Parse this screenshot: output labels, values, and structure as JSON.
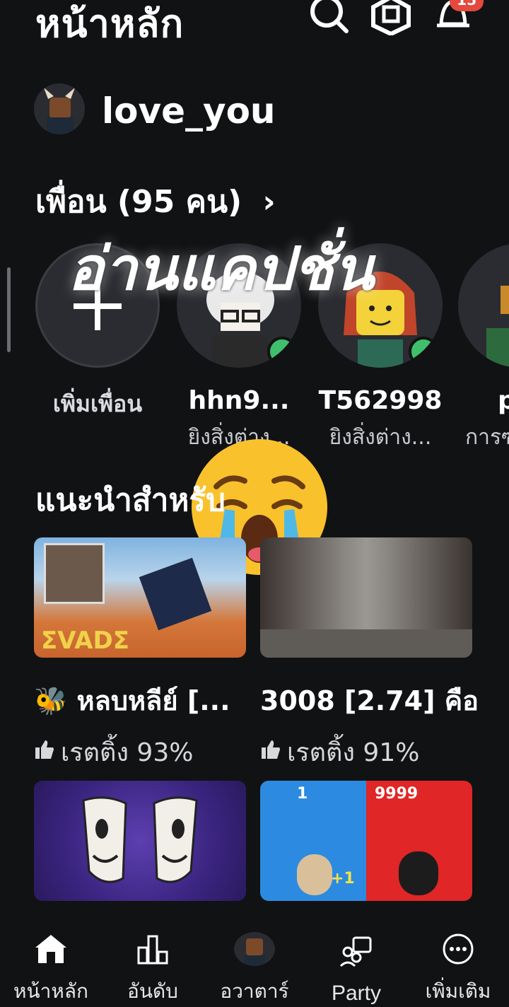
{
  "header": {
    "title": "หน้าหลัก",
    "notification_count": "15",
    "icons": [
      "search-icon",
      "robux-icon",
      "bell-icon"
    ]
  },
  "profile": {
    "username": "love_you"
  },
  "friends": {
    "heading": "เพื่อน (95 คน)",
    "items": [
      {
        "name": "เพิ่มเพื่อน",
        "sub": ""
      },
      {
        "name": "hhn9...",
        "sub": "ยิงสิ่งต่าง...",
        "online": true
      },
      {
        "name": "T562998",
        "sub": "ยิงสิ่งต่าง...",
        "online": true
      },
      {
        "name": "p",
        "sub": "การซ"
      }
    ]
  },
  "overlay": {
    "caption": "อ่านแคปชั่น",
    "emoji": "😭"
  },
  "recommended": {
    "heading": "แนะนำสำหรับ",
    "games": [
      {
        "title": "🐝 หลบหลีย์ [...",
        "rating": "เรตติ้ง 93%",
        "thumb_label": "ΣVADΣ"
      },
      {
        "title": "3008 [2.74] คือ",
        "rating": "เรตติ้ง 91%",
        "thumb_label": ""
      },
      {
        "title": "",
        "rating": "",
        "thumb_label": ""
      },
      {
        "title": "",
        "rating": "",
        "thumb_label_left": "1",
        "thumb_label_right": "9999",
        "thumb_plus": "+1"
      }
    ]
  },
  "bottom_nav": [
    {
      "label": "หน้าหลัก",
      "icon": "home-icon"
    },
    {
      "label": "อันดับ",
      "icon": "leaderboard-icon"
    },
    {
      "label": "อวาตาร์",
      "icon": "avatar-icon"
    },
    {
      "label": "Party",
      "icon": "party-icon"
    },
    {
      "label": "เพิ่มเติม",
      "icon": "more-icon"
    }
  ],
  "colors": {
    "background": "#111214",
    "online": "#3fbf6b",
    "badge": "#e5483c"
  }
}
